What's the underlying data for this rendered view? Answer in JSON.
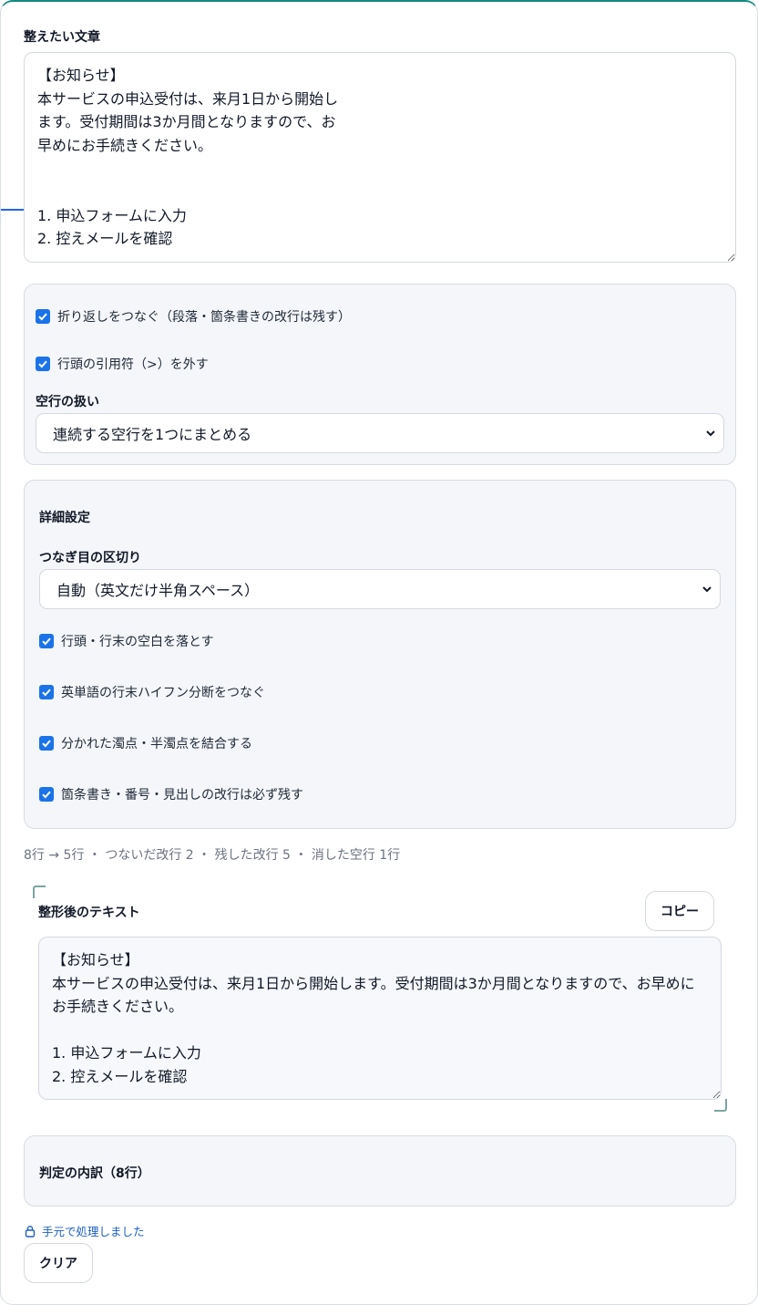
{
  "source": {
    "label": "整えたい文章",
    "text": "【お知らせ】\n本サービスの申込受付は、来月1日から開始し\nます。受付期間は3か月間となりますので、お\n早めにお手続きください。\n\n\n1. 申込フォームに入力\n2. 控えメールを確認"
  },
  "options": {
    "join_wraps": "折り返しをつなぐ（段落・箇条書きの改行は残す）",
    "strip_quotes": "行頭の引用符（>）を外す",
    "blank_lines_label": "空行の扱い",
    "blank_lines_value": "連続する空行を1つにまとめる"
  },
  "advanced": {
    "title": "詳細設定",
    "separator_label": "つなぎ目の区切り",
    "separator_value": "自動（英文だけ半角スペース）",
    "trim_spaces": "行頭・行末の空白を落とす",
    "join_hyphen": "英単語の行末ハイフン分断をつなぐ",
    "merge_dakuten": "分かれた濁点・半濁点を結合する",
    "keep_list_breaks": "箇条書き・番号・見出しの改行は必ず残す"
  },
  "stats": "8行 → 5行 ・ つないだ改行 2 ・ 残した改行 5 ・ 消した空行 1行",
  "output": {
    "label": "整形後のテキスト",
    "copy_label": "コピー",
    "text": "【お知らせ】\n本サービスの申込受付は、来月1日から開始します。受付期間は3か月間となりますので、お早めにお手続きください。\n\n1. 申込フォームに入力\n2. 控えメールを確認"
  },
  "breakdown": {
    "title": "判定の内訳（8行）"
  },
  "footer": {
    "local_note": "手元で処理しました",
    "clear_label": "クリア"
  },
  "colors": {
    "accent": "#138a80",
    "checkbox": "#1a73e8",
    "note": "#1d5fc4"
  }
}
